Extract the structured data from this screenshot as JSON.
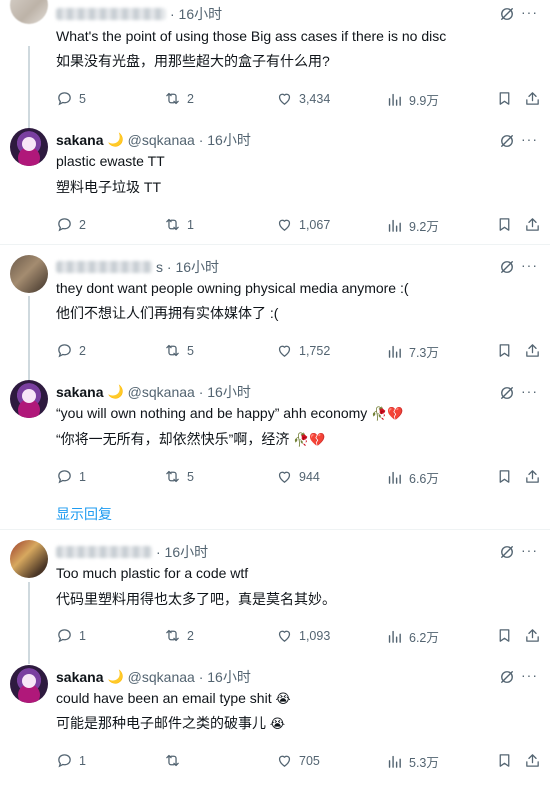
{
  "tweets": [
    {
      "name": "",
      "handle_time": "· 16小时",
      "text_en": "What's the point of using those Big ass cases if there is no disc",
      "text_zh": "如果没有光盘，用那些超大的盒子有什么用?",
      "replies": "5",
      "retweets": "2",
      "likes": "3,434",
      "views": "9.9万"
    },
    {
      "name": "sakana",
      "handle": "@sqkanaa · 16小时",
      "text_en": "plastic ewaste TT",
      "text_zh": "塑料电子垃圾 TT",
      "replies": "2",
      "retweets": "1",
      "likes": "1,067",
      "views": "9.2万"
    },
    {
      "name": "",
      "handle_time": "s · 16小时",
      "text_en": "they dont want people owning physical media anymore :(",
      "text_zh": "他们不想让人们再拥有实体媒体了 :(",
      "replies": "2",
      "retweets": "5",
      "likes": "1,752",
      "views": "7.3万"
    },
    {
      "name": "sakana",
      "handle": "@sqkanaa · 16小时",
      "text_en": "“you will own nothing and be happy” ahh economy",
      "text_zh": "“你将一无所有，却依然快乐”啊，经济",
      "emoji": "🥀💔",
      "replies": "1",
      "retweets": "5",
      "likes": "944",
      "views": "6.6万"
    },
    {
      "name": "",
      "handle_time": "· 16小时",
      "text_en": "Too much plastic for a code wtf",
      "text_zh": "代码里塑料用得也太多了吧，真是莫名其妙。",
      "replies": "1",
      "retweets": "2",
      "likes": "1,093",
      "views": "6.2万"
    },
    {
      "name": "sakana",
      "handle": "@sqkanaa · 16小时",
      "text_en": "could have been an email type shit",
      "text_zh": "可能是那种电子邮件之类的破事儿",
      "emoji": "😭",
      "replies": "1",
      "retweets": "",
      "likes": "705",
      "views": "5.3万"
    }
  ],
  "show_replies": "显示回复",
  "colors": {
    "link": "#1d9bf0",
    "muted": "#536471",
    "text": "#0f1419",
    "divider": "#eff3f4"
  },
  "icons": [
    "reply-icon",
    "retweet-icon",
    "like-icon",
    "views-icon",
    "bookmark-icon",
    "share-icon",
    "grok-icon",
    "more-icon",
    "moon-emoji"
  ]
}
